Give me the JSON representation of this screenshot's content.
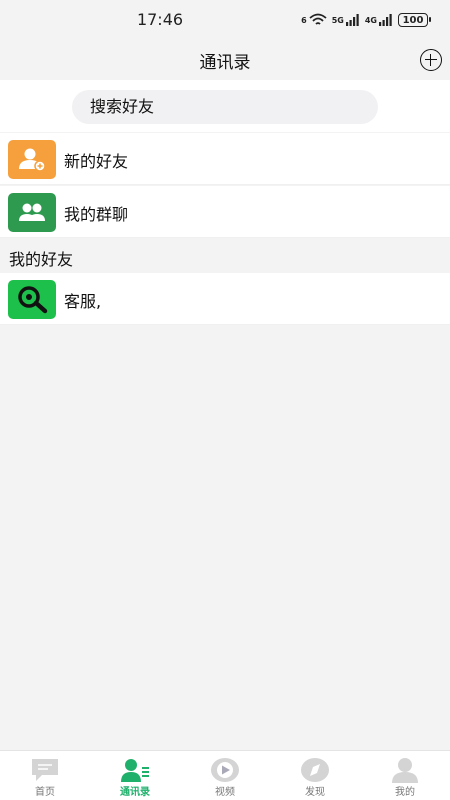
{
  "status_bar": {
    "time": "17:46",
    "wifi_label": "6",
    "signal1_label": "5G",
    "signal2_label": "4G",
    "battery": "100"
  },
  "header": {
    "title": "通讯录"
  },
  "search": {
    "placeholder": "搜索好友"
  },
  "menu": [
    {
      "label": "新的好友",
      "icon": "add-friend-icon",
      "color": "#f5a03c"
    },
    {
      "label": "我的群聊",
      "icon": "group-chat-icon",
      "color": "#2d9a4f"
    }
  ],
  "friends_section": {
    "title": "我的好友"
  },
  "friends": [
    {
      "name": "客服,",
      "icon": "search-avatar-icon",
      "color": "#1ec04c"
    }
  ],
  "tabs": [
    {
      "label": "首页",
      "icon": "chat-icon",
      "active": false
    },
    {
      "label": "通讯录",
      "icon": "contacts-icon",
      "active": true
    },
    {
      "label": "视频",
      "icon": "video-icon",
      "active": false
    },
    {
      "label": "发现",
      "icon": "discover-icon",
      "active": false
    },
    {
      "label": "我的",
      "icon": "profile-icon",
      "active": false
    }
  ],
  "colors": {
    "accent": "#1fb06b",
    "inactive": "#d4d4d4"
  }
}
